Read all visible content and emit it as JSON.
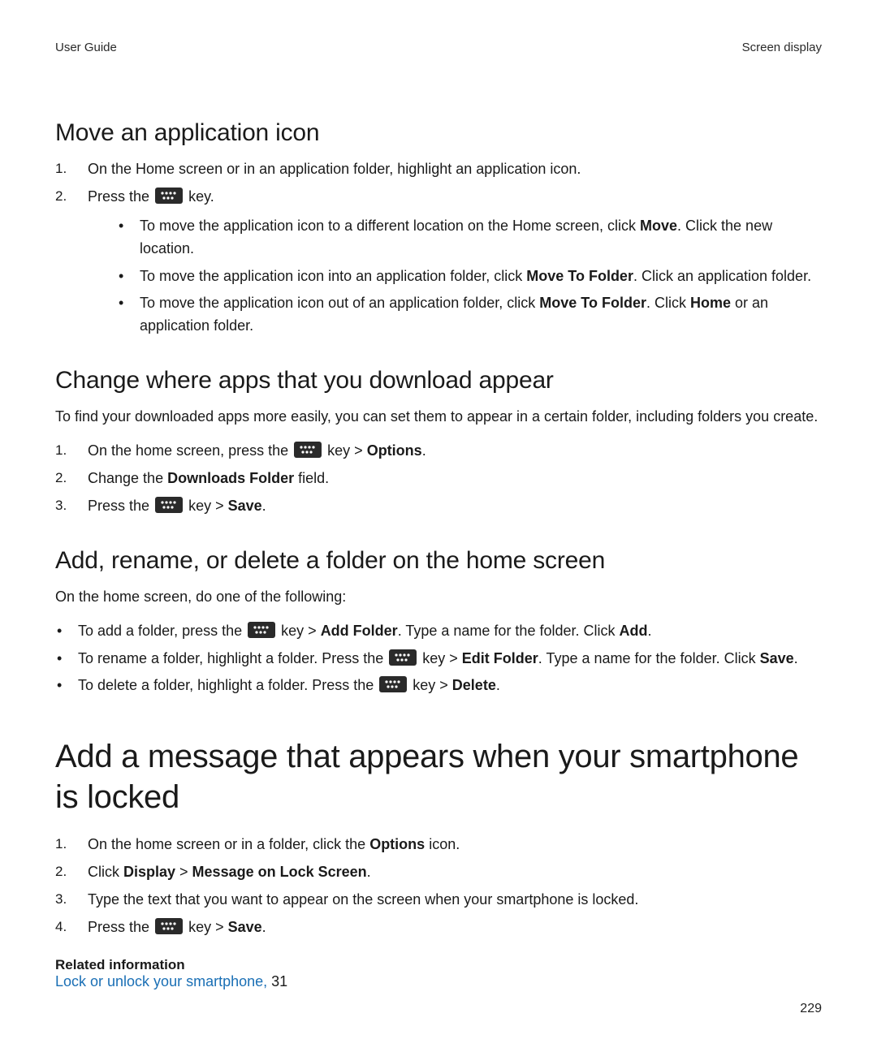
{
  "header": {
    "left": "User Guide",
    "right": "Screen display"
  },
  "page_number": "229",
  "sec1": {
    "title": "Move an application icon",
    "step1": "On the Home screen or in an application folder, highlight an application icon.",
    "step2_a": "Press the ",
    "step2_b": " key.",
    "b1_a": "To move the application icon to a different location on the Home screen, click ",
    "b1_bold": "Move",
    "b1_b": ". Click the new location.",
    "b2_a": "To move the application icon into an application folder, click ",
    "b2_bold": "Move To Folder",
    "b2_b": ". Click an application folder.",
    "b3_a": "To move the application icon out of an application folder, click ",
    "b3_bold1": "Move To Folder",
    "b3_mid": ". Click ",
    "b3_bold2": "Home",
    "b3_b": " or an application folder."
  },
  "sec2": {
    "title": "Change where apps that you download appear",
    "intro": "To find your downloaded apps more easily, you can set them to appear in a certain folder, including folders you create.",
    "s1_a": "On the home screen, press the ",
    "s1_mid": " key > ",
    "s1_bold": "Options",
    "s1_b": ".",
    "s2_a": "Change the ",
    "s2_bold": "Downloads Folder",
    "s2_b": " field.",
    "s3_a": "Press the ",
    "s3_mid": " key > ",
    "s3_bold": "Save",
    "s3_b": "."
  },
  "sec3": {
    "title": "Add, rename, or delete a folder on the home screen",
    "intro": "On the home screen, do one of the following:",
    "b1_a": "To add a folder, press the ",
    "b1_mid": " key > ",
    "b1_bold1": "Add Folder",
    "b1_c": ". Type a name for the folder. Click ",
    "b1_bold2": "Add",
    "b1_d": ".",
    "b2_a": "To rename a folder, highlight a folder. Press the ",
    "b2_mid": " key > ",
    "b2_bold1": "Edit Folder",
    "b2_c": ". Type a name for the folder. Click ",
    "b2_bold2": "Save",
    "b2_d": ".",
    "b3_a": "To delete a folder, highlight a folder. Press the ",
    "b3_mid": " key > ",
    "b3_bold": "Delete",
    "b3_b": "."
  },
  "sec4": {
    "title": "Add a message that appears when your smartphone is locked",
    "s1_a": "On the home screen or in a folder, click the ",
    "s1_bold": "Options",
    "s1_b": " icon.",
    "s2_a": "Click ",
    "s2_bold1": "Display",
    "s2_mid": " > ",
    "s2_bold2": "Message on Lock Screen",
    "s2_b": ".",
    "s3": "Type the text that you want to appear on the screen when your smartphone is locked.",
    "s4_a": "Press the ",
    "s4_mid": " key > ",
    "s4_bold": "Save",
    "s4_b": "."
  },
  "related": {
    "heading": "Related information",
    "link_text": "Lock or unlock your smartphone,",
    "page_ref": " 31"
  }
}
